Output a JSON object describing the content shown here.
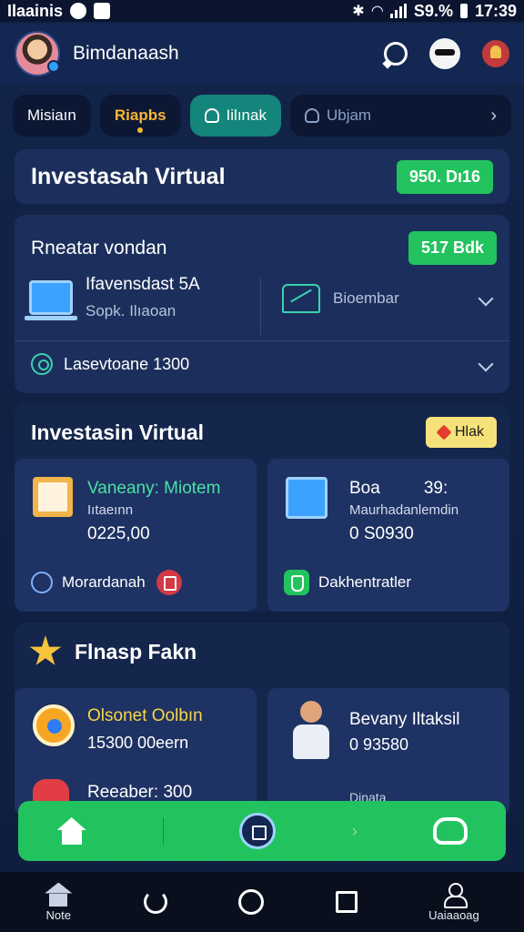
{
  "status_bar": {
    "left_text": "Ilaainis",
    "battery": "S9.%",
    "time": "17:39"
  },
  "app": {
    "name": "Bimdanaash"
  },
  "tabs": [
    {
      "label": "Misiaın"
    },
    {
      "label": "Riapbs"
    },
    {
      "label": "Iilınak"
    },
    {
      "label": "Ubjam"
    }
  ],
  "title_card": {
    "title": "Investasah Virtual",
    "value": "950. Dı16"
  },
  "summary": {
    "label": "Rneatar vondan",
    "value": "517 Bdk",
    "item_left_title": "Ifavensdast 5A",
    "item_left_sub": "Sopk. Ilıaoan",
    "item_right_label": "Bioembar",
    "row_label": "Lasevtoane 1300"
  },
  "invest": {
    "title": "Investasin Virtual",
    "badge": "Hlak",
    "card_left": {
      "title": "Vaneany: Miotem",
      "sub": "Iıtaeınn",
      "value": "0225,00",
      "footer": "Morardanah"
    },
    "card_right": {
      "title": "Boa",
      "extra": "39:",
      "sub": "Maurhadanlemdin",
      "value": "0 S0930",
      "footer": "Dakhentratler"
    }
  },
  "fp": {
    "title": "Flnasp Fakn",
    "card_left": {
      "title": "Olsonet Oolbın",
      "value": "15300 00eern",
      "extra": "Reeaber: 300"
    },
    "card_right": {
      "title": "Bevany Iltaksil",
      "value": "0 93580",
      "extra": "Dinata"
    }
  },
  "sysnav": {
    "home_label": "Note",
    "profile_label": "Uaiaaoag"
  }
}
